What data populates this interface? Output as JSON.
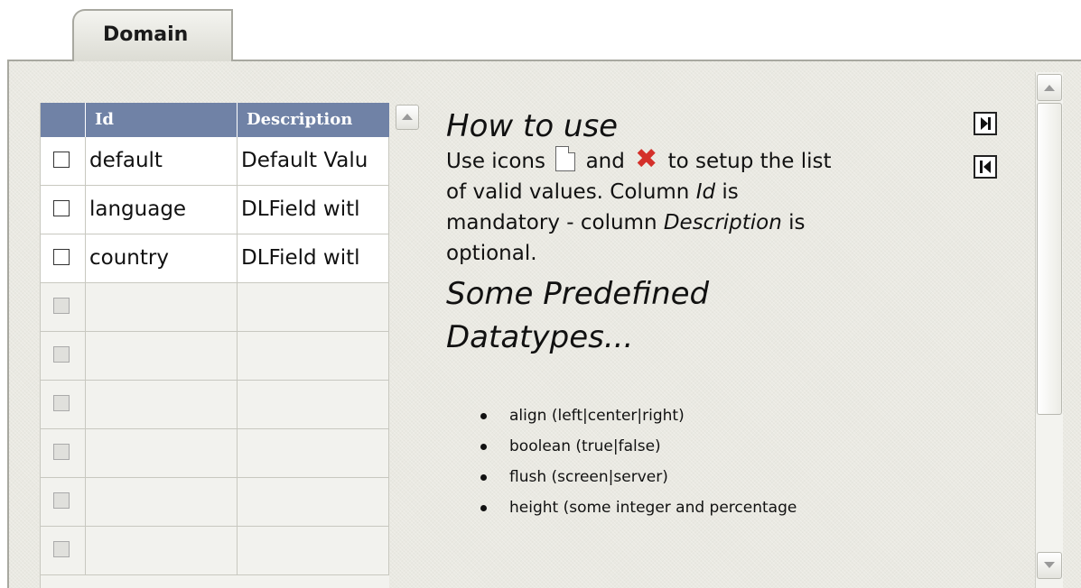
{
  "tab": {
    "label": "Domain"
  },
  "grid": {
    "columns": [
      "Id",
      "Description"
    ],
    "rows": [
      {
        "id": "default",
        "description": "Default Valu"
      },
      {
        "id": "language",
        "description": "DLField witl"
      },
      {
        "id": "country",
        "description": "DLField witl"
      }
    ],
    "empty_rows": 6
  },
  "help": {
    "title": "How to use",
    "line1_a": "Use icons",
    "line1_b": "and",
    "line1_c": "to setup the list",
    "line2_a": "of valid values. Column",
    "line2_id": "Id",
    "line2_b": "is",
    "line3_a": "mandatory - column",
    "line3_desc": "Description",
    "line3_b": "is",
    "line4": "optional.",
    "subtitle_1": "Some Predefined",
    "subtitle_2": "Datatypes...",
    "datatypes": [
      "align (left|center|right)",
      "boolean (true|false)",
      "flush (screen|server)",
      "height (some integer and percentage"
    ]
  },
  "colors": {
    "header_bg": "#7082a6",
    "delete_icon": "#d4302a",
    "panel_bg": "#eae9e2"
  },
  "icons": {
    "new": "new-document-icon",
    "delete": "delete-x-icon",
    "next": "last-page-icon",
    "prev": "first-page-icon"
  }
}
